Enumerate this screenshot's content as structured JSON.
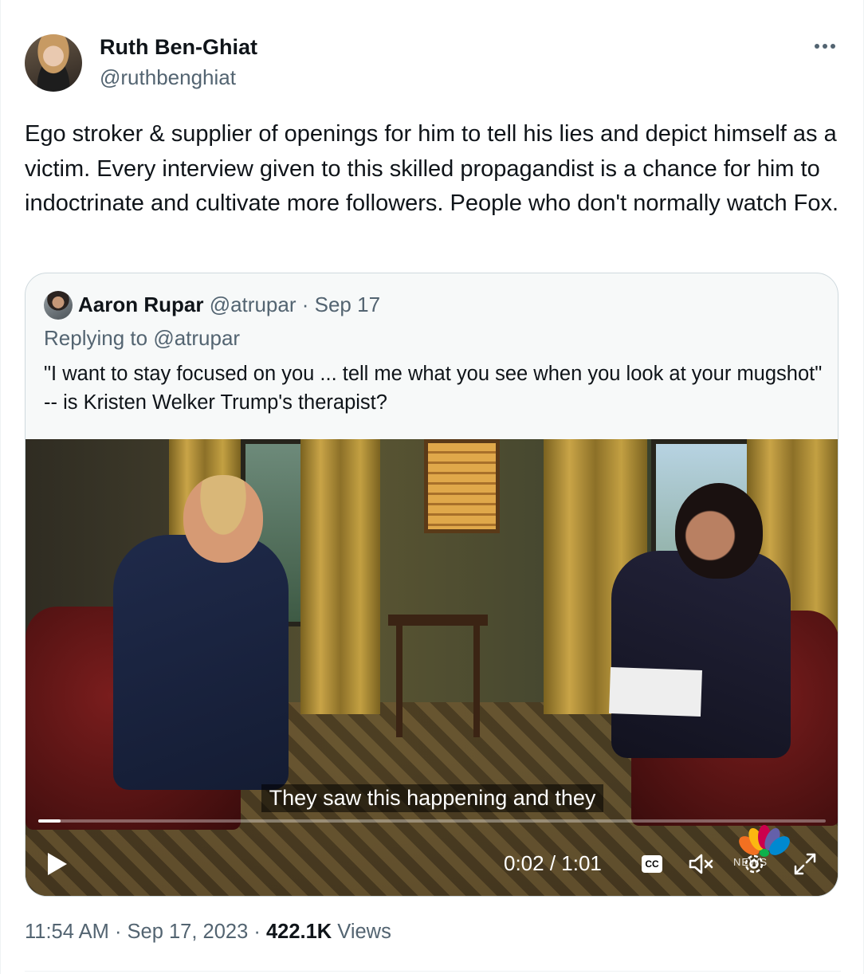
{
  "author": {
    "name": "Ruth Ben-Ghiat",
    "handle": "@ruthbenghiat"
  },
  "more_icon": "more-icon",
  "tweet": {
    "text": "Ego stroker &  supplier of openings for him to tell his lies and depict himself as a victim. Every interview given to this skilled propagandist is a chance for him to indoctrinate and cultivate more followers. People who don't normally watch Fox."
  },
  "quoted": {
    "name": "Aaron Rupar",
    "handle": "@atrupar",
    "separator": "·",
    "date": "Sep 17",
    "replying_prefix": "Replying to",
    "replying_to": "@atrupar",
    "text": "\"I want to stay focused on you ... tell me what you see when you look at your mugshot\" -- is Kristen Welker Trump's therapist?",
    "video": {
      "subtitle": "They saw this happening and they",
      "time": "0:02 / 1:01",
      "progress": 0.028,
      "cc_label": "CC",
      "logo_text": "NEWS",
      "icons": [
        "play-icon",
        "cc-icon",
        "mute-icon",
        "settings-icon",
        "fullscreen-icon"
      ]
    }
  },
  "footer": {
    "time": "11:54 AM",
    "sep1": "·",
    "date": "Sep 17, 2023",
    "sep2": "·",
    "views_count": "422.1K",
    "views_label": "Views"
  },
  "colors": {
    "text": "#0f1419",
    "secondary": "#536471",
    "border": "#cfd9de"
  }
}
